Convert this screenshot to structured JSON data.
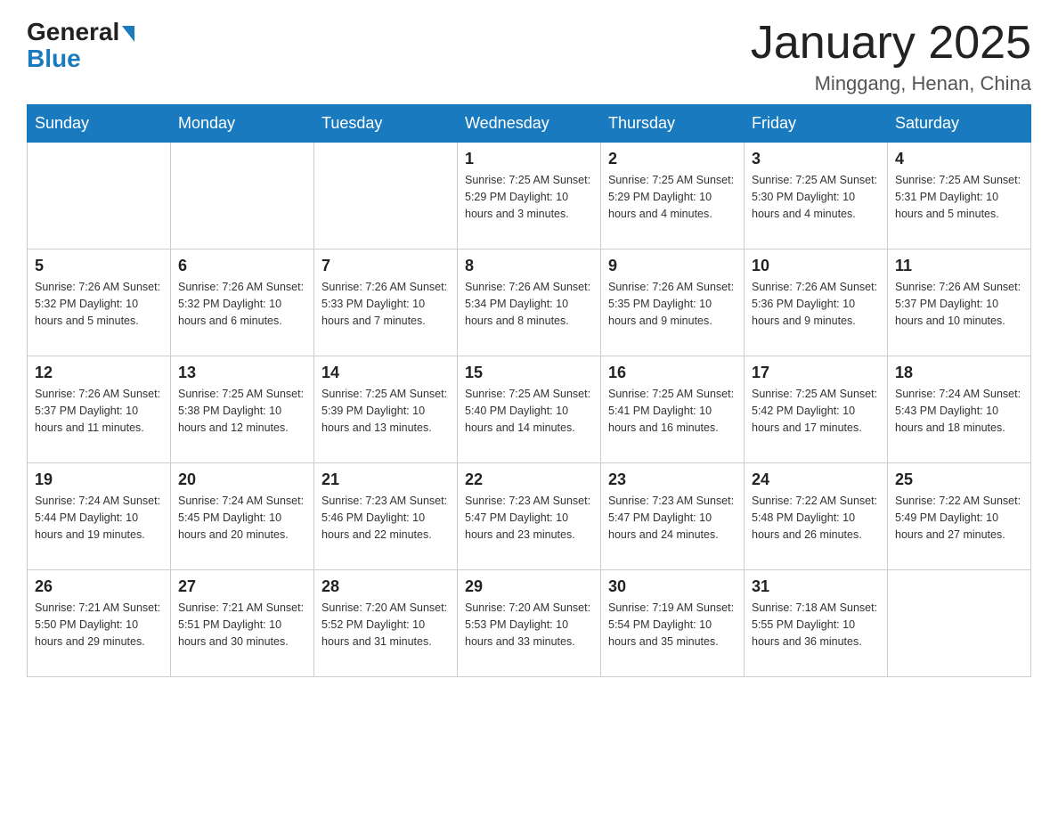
{
  "header": {
    "logo_general": "General",
    "logo_blue": "Blue",
    "title": "January 2025",
    "subtitle": "Minggang, Henan, China"
  },
  "weekdays": [
    "Sunday",
    "Monday",
    "Tuesday",
    "Wednesday",
    "Thursday",
    "Friday",
    "Saturday"
  ],
  "weeks": [
    [
      {
        "day": "",
        "info": ""
      },
      {
        "day": "",
        "info": ""
      },
      {
        "day": "",
        "info": ""
      },
      {
        "day": "1",
        "info": "Sunrise: 7:25 AM\nSunset: 5:29 PM\nDaylight: 10 hours\nand 3 minutes."
      },
      {
        "day": "2",
        "info": "Sunrise: 7:25 AM\nSunset: 5:29 PM\nDaylight: 10 hours\nand 4 minutes."
      },
      {
        "day": "3",
        "info": "Sunrise: 7:25 AM\nSunset: 5:30 PM\nDaylight: 10 hours\nand 4 minutes."
      },
      {
        "day": "4",
        "info": "Sunrise: 7:25 AM\nSunset: 5:31 PM\nDaylight: 10 hours\nand 5 minutes."
      }
    ],
    [
      {
        "day": "5",
        "info": "Sunrise: 7:26 AM\nSunset: 5:32 PM\nDaylight: 10 hours\nand 5 minutes."
      },
      {
        "day": "6",
        "info": "Sunrise: 7:26 AM\nSunset: 5:32 PM\nDaylight: 10 hours\nand 6 minutes."
      },
      {
        "day": "7",
        "info": "Sunrise: 7:26 AM\nSunset: 5:33 PM\nDaylight: 10 hours\nand 7 minutes."
      },
      {
        "day": "8",
        "info": "Sunrise: 7:26 AM\nSunset: 5:34 PM\nDaylight: 10 hours\nand 8 minutes."
      },
      {
        "day": "9",
        "info": "Sunrise: 7:26 AM\nSunset: 5:35 PM\nDaylight: 10 hours\nand 9 minutes."
      },
      {
        "day": "10",
        "info": "Sunrise: 7:26 AM\nSunset: 5:36 PM\nDaylight: 10 hours\nand 9 minutes."
      },
      {
        "day": "11",
        "info": "Sunrise: 7:26 AM\nSunset: 5:37 PM\nDaylight: 10 hours\nand 10 minutes."
      }
    ],
    [
      {
        "day": "12",
        "info": "Sunrise: 7:26 AM\nSunset: 5:37 PM\nDaylight: 10 hours\nand 11 minutes."
      },
      {
        "day": "13",
        "info": "Sunrise: 7:25 AM\nSunset: 5:38 PM\nDaylight: 10 hours\nand 12 minutes."
      },
      {
        "day": "14",
        "info": "Sunrise: 7:25 AM\nSunset: 5:39 PM\nDaylight: 10 hours\nand 13 minutes."
      },
      {
        "day": "15",
        "info": "Sunrise: 7:25 AM\nSunset: 5:40 PM\nDaylight: 10 hours\nand 14 minutes."
      },
      {
        "day": "16",
        "info": "Sunrise: 7:25 AM\nSunset: 5:41 PM\nDaylight: 10 hours\nand 16 minutes."
      },
      {
        "day": "17",
        "info": "Sunrise: 7:25 AM\nSunset: 5:42 PM\nDaylight: 10 hours\nand 17 minutes."
      },
      {
        "day": "18",
        "info": "Sunrise: 7:24 AM\nSunset: 5:43 PM\nDaylight: 10 hours\nand 18 minutes."
      }
    ],
    [
      {
        "day": "19",
        "info": "Sunrise: 7:24 AM\nSunset: 5:44 PM\nDaylight: 10 hours\nand 19 minutes."
      },
      {
        "day": "20",
        "info": "Sunrise: 7:24 AM\nSunset: 5:45 PM\nDaylight: 10 hours\nand 20 minutes."
      },
      {
        "day": "21",
        "info": "Sunrise: 7:23 AM\nSunset: 5:46 PM\nDaylight: 10 hours\nand 22 minutes."
      },
      {
        "day": "22",
        "info": "Sunrise: 7:23 AM\nSunset: 5:47 PM\nDaylight: 10 hours\nand 23 minutes."
      },
      {
        "day": "23",
        "info": "Sunrise: 7:23 AM\nSunset: 5:47 PM\nDaylight: 10 hours\nand 24 minutes."
      },
      {
        "day": "24",
        "info": "Sunrise: 7:22 AM\nSunset: 5:48 PM\nDaylight: 10 hours\nand 26 minutes."
      },
      {
        "day": "25",
        "info": "Sunrise: 7:22 AM\nSunset: 5:49 PM\nDaylight: 10 hours\nand 27 minutes."
      }
    ],
    [
      {
        "day": "26",
        "info": "Sunrise: 7:21 AM\nSunset: 5:50 PM\nDaylight: 10 hours\nand 29 minutes."
      },
      {
        "day": "27",
        "info": "Sunrise: 7:21 AM\nSunset: 5:51 PM\nDaylight: 10 hours\nand 30 minutes."
      },
      {
        "day": "28",
        "info": "Sunrise: 7:20 AM\nSunset: 5:52 PM\nDaylight: 10 hours\nand 31 minutes."
      },
      {
        "day": "29",
        "info": "Sunrise: 7:20 AM\nSunset: 5:53 PM\nDaylight: 10 hours\nand 33 minutes."
      },
      {
        "day": "30",
        "info": "Sunrise: 7:19 AM\nSunset: 5:54 PM\nDaylight: 10 hours\nand 35 minutes."
      },
      {
        "day": "31",
        "info": "Sunrise: 7:18 AM\nSunset: 5:55 PM\nDaylight: 10 hours\nand 36 minutes."
      },
      {
        "day": "",
        "info": ""
      }
    ]
  ]
}
